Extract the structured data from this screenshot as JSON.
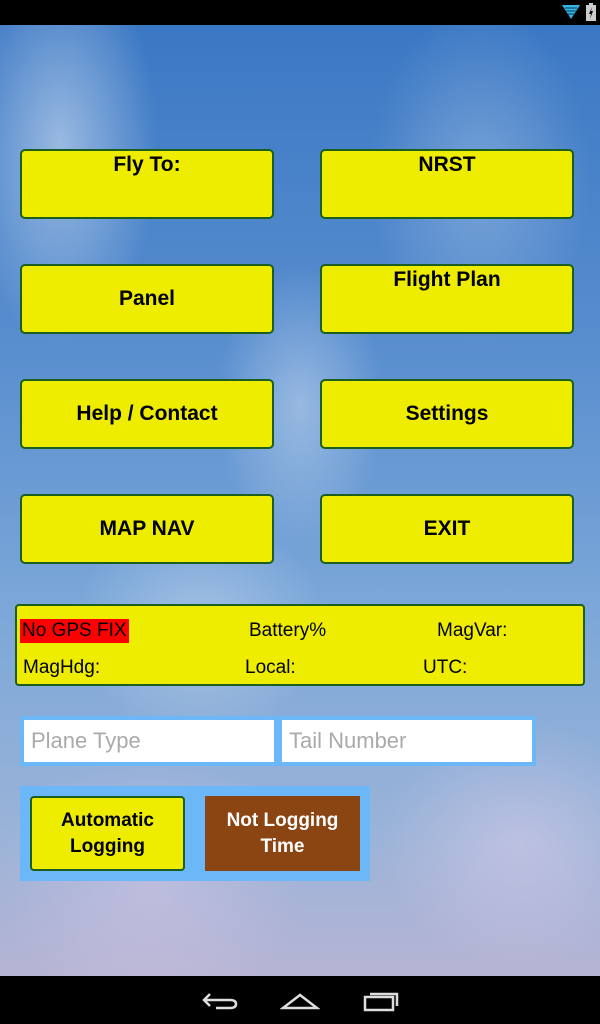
{
  "buttons": {
    "fly_to": "Fly To:",
    "nrst": "NRST",
    "panel": "Panel",
    "flight_plan": "Flight Plan",
    "help_contact": "Help / Contact",
    "settings": "Settings",
    "map_nav": "MAP NAV",
    "exit": "EXIT"
  },
  "status": {
    "gps": "No GPS FIX",
    "battery": "Battery%",
    "magvar": "MagVar:",
    "maghdg": "MagHdg:",
    "local": "Local:",
    "utc": "UTC:"
  },
  "inputs": {
    "plane_type": {
      "placeholder": "Plane Type",
      "value": ""
    },
    "tail_number": {
      "placeholder": "Tail Number",
      "value": ""
    }
  },
  "logging": {
    "automatic": "Automatic Logging",
    "not_logging": "Not Logging Time"
  },
  "colors": {
    "button": "#eeed00",
    "button_border": "#1b5e20",
    "gps_alert": "#ff0000",
    "logging_status": "#8b4513",
    "group_bg": "#6bb7f7"
  },
  "icons": {
    "status": [
      "wifi-icon",
      "battery-icon"
    ],
    "nav": [
      "back-icon",
      "home-icon",
      "recents-icon"
    ]
  }
}
